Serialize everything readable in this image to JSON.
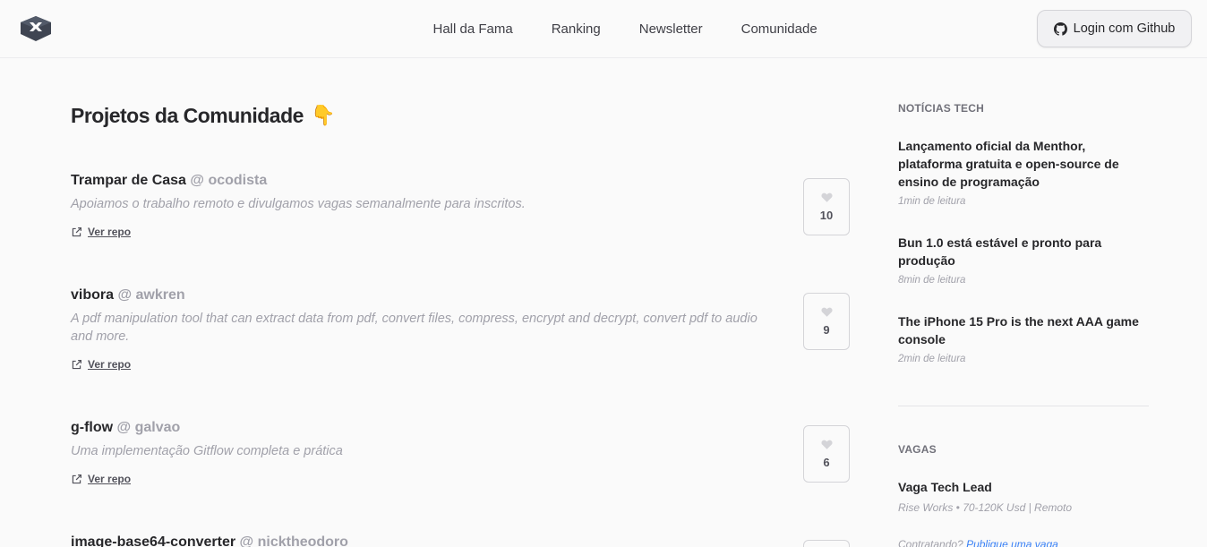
{
  "nav": {
    "items": [
      "Hall da Fama",
      "Ranking",
      "Newsletter",
      "Comunidade"
    ],
    "login_label": "Login com Github"
  },
  "main": {
    "title": "Projetos da Comunidade",
    "title_emoji": "👇",
    "repo_label": "Ver repo",
    "projects": [
      {
        "name": "Trampar de Casa",
        "author": "@ ocodista",
        "description": "Apoiamos o trabalho remoto e divulgamos vagas semanalmente para inscritos.",
        "likes": "10"
      },
      {
        "name": "vibora",
        "author": "@ awkren",
        "description": "A pdf manipulation tool that can extract data from pdf, convert files, compress, encrypt and decrypt, convert pdf to audio and more.",
        "likes": "9"
      },
      {
        "name": "g-flow",
        "author": "@ galvao",
        "description": "Uma implementação Gitflow completa e prática",
        "likes": "6"
      },
      {
        "name": "image-base64-converter",
        "author": "@ nicktheodoro",
        "description": "",
        "likes": ""
      }
    ]
  },
  "sidebar": {
    "news_heading": "NOTÍCIAS TECH",
    "news": [
      {
        "title": "Lançamento oficial da Menthor, plataforma gratuita e open-source de ensino de programação",
        "meta": "1min de leitura"
      },
      {
        "title": "Bun 1.0 está estável e pronto para produção",
        "meta": "8min de leitura"
      },
      {
        "title": "The iPhone 15 Pro is the next AAA game console",
        "meta": "2min de leitura"
      }
    ],
    "jobs_heading": "VAGAS",
    "jobs": [
      {
        "title": "Vaga Tech Lead",
        "meta": "Rise Works • 70-120K Usd | Remoto"
      }
    ],
    "hire_prefix": "Contratando?",
    "hire_link": "Publique uma vaga"
  },
  "colors": {
    "background": "#fafafa",
    "text": "#27272a",
    "muted": "#a1a1aa",
    "link": "#3b82f6"
  }
}
